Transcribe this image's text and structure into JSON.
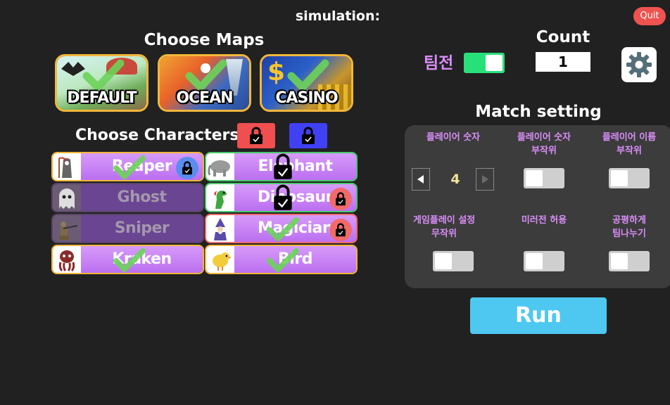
{
  "header": {
    "title": "simulation:",
    "quit_label": "Quit"
  },
  "maps": {
    "title": "Choose Maps",
    "items": [
      {
        "label": "DEFAULT",
        "selected": true
      },
      {
        "label": "OCEAN",
        "selected": true
      },
      {
        "label": "CASINO",
        "selected": true
      }
    ]
  },
  "characters": {
    "title": "Choose Characters",
    "lock_buttons": [
      {
        "color": "#ef4f4f"
      },
      {
        "color": "#4040f5"
      }
    ],
    "items": [
      {
        "name": "Reaper",
        "state": "selected",
        "badge": "blue-lock"
      },
      {
        "name": "Elephant",
        "state": "locked-green"
      },
      {
        "name": "Ghost",
        "state": "disabled"
      },
      {
        "name": "Dinosaur",
        "state": "locked-green",
        "badge": "red-lock"
      },
      {
        "name": "Sniper",
        "state": "disabled"
      },
      {
        "name": "Magician",
        "state": "selected-red",
        "badge": "red-lock"
      },
      {
        "name": "Kraken",
        "state": "selected"
      },
      {
        "name": "Bird",
        "state": "selected"
      }
    ]
  },
  "team_battle": {
    "label": "팀전",
    "on": true
  },
  "count": {
    "title": "Count",
    "value": "1"
  },
  "settings": {
    "icon": "gear-icon"
  },
  "match_setting": {
    "title": "Match setting",
    "player_count": {
      "label": "플레이어 숫자",
      "value": "4"
    },
    "options": [
      {
        "label_1": "플레이어 숫자",
        "label_2": "부작위",
        "on": false
      },
      {
        "label_1": "플레이어 이름",
        "label_2": "부작위",
        "on": false
      },
      {
        "label_1": "게임플레이 설정",
        "label_2": "무작위",
        "on": false
      },
      {
        "label_1": "미러전 허용",
        "label_2": "",
        "on": false
      },
      {
        "label_1": "공평하게",
        "label_2": "팀나누기",
        "on": false
      }
    ]
  },
  "run": {
    "label": "Run"
  },
  "colors": {
    "accent_purple": "#d98ef7",
    "toggle_on": "#28e07a",
    "run_button": "#4ec8f1",
    "card_border": "#f2b73b"
  }
}
